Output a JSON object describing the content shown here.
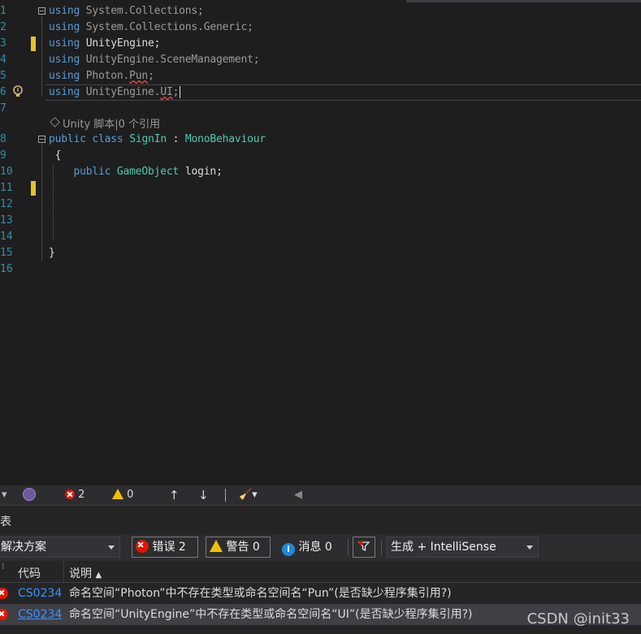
{
  "editor": {
    "line_numbers": [
      "1",
      "2",
      "3",
      "4",
      "5",
      "6",
      "7",
      "8",
      "9",
      "10",
      "11",
      "12",
      "13",
      "14",
      "15",
      "16"
    ],
    "usings": [
      {
        "kw": "using",
        "ns": "System.Collections;"
      },
      {
        "kw": "using",
        "ns": "System.Collections.Generic;"
      },
      {
        "kw": "using",
        "ns": "UnityEngine;"
      },
      {
        "kw": "using",
        "ns": "UnityEngine.SceneManagement;"
      },
      {
        "kw": "using",
        "ns_prefix": "Photon.",
        "ns_err": "Pun",
        "ns_suffix": ";"
      },
      {
        "kw": "using",
        "ns_prefix": "UnityEngine.",
        "ns_err": "UI",
        "ns_suffix": ";"
      }
    ],
    "codelens": "Unity 脚本|0 个引用",
    "class_line": {
      "public": "public",
      "class": "class",
      "name": "SignIn",
      "colon": " : ",
      "base": "MonoBehaviour"
    },
    "open_brace": "{",
    "field_line": {
      "public": "public",
      "type": "GameObject",
      "rest": " login;"
    },
    "close_brace": "}"
  },
  "status_strip": {
    "errors": "2",
    "warnings": "0",
    "up_arrow": "↑",
    "down_arrow": "↓"
  },
  "panel": {
    "title": "表"
  },
  "toolbar": {
    "scope": "解决方案",
    "errors_label": "错误 2",
    "warnings_label": "警告 0",
    "messages_label": "消息 0",
    "build_filter": "生成 + IntelliSense"
  },
  "error_list": {
    "columns": {
      "code": "代码",
      "desc": "说明"
    },
    "rows": [
      {
        "code": "CS0234",
        "desc": "命名空间“Photon”中不存在类型或命名空间名“Pun”(是否缺少程序集引用?)"
      },
      {
        "code": "CS0234",
        "desc": "命名空间“UnityEngine”中不存在类型或命名空间名“UI”(是否缺少程序集引用?)"
      }
    ]
  },
  "watermark": "CSDN @init33",
  "colors": {
    "keyword": "#569cd6",
    "type": "#4ec9b0",
    "error": "#e51400",
    "warning": "#f0c000",
    "linenum": "#2b91af"
  }
}
